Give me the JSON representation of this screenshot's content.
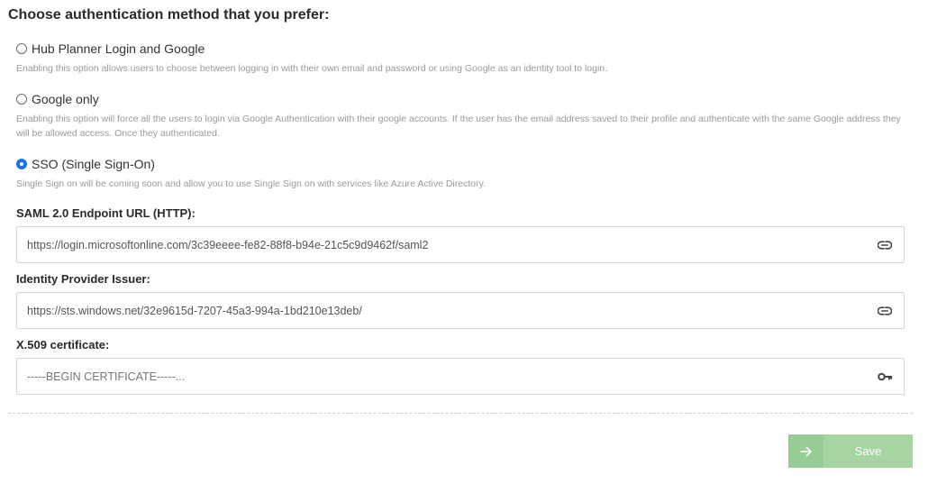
{
  "heading": "Choose authentication method that you prefer:",
  "options": [
    {
      "label": "Hub Planner Login and Google",
      "description": "Enabling this option allows users to choose between logging in with their own email and password or using Google as an identity tool to login.",
      "selected": false
    },
    {
      "label": "Google only",
      "description": "Enabling this option will force all the users to login via Google Authentication with their google accounts. If the user has the email address saved to their profile and authenticate with the same Google address they will be allowed access. Once they authenticated.",
      "selected": false
    },
    {
      "label": "SSO (Single Sign-On)",
      "description": "Single Sign on will be coming soon and allow you to use Single Sign on with services like Azure Active Directory.",
      "selected": true
    }
  ],
  "fields": {
    "saml_url": {
      "label": "SAML 2.0 Endpoint URL (HTTP):",
      "value": "https://login.microsoftonline.com/3c39eeee-fe82-88f8-b94e-21c5c9d9462f/saml2",
      "icon": "link-icon"
    },
    "issuer": {
      "label": "Identity Provider Issuer:",
      "value": "https://sts.windows.net/32e9615d-7207-45a3-994a-1bd210e13deb/",
      "icon": "link-icon"
    },
    "certificate": {
      "label": "X.509 certificate:",
      "placeholder": "-----BEGIN CERTIFICATE-----...",
      "value": "",
      "icon": "key-icon"
    }
  },
  "save_button": {
    "label": "Save",
    "icon": "arrow-right-icon",
    "color": "#a6d4a3",
    "accent": "#97cd94"
  },
  "colors": {
    "radio_selected": "#1a73e8",
    "description_text": "#9a9a9a"
  }
}
